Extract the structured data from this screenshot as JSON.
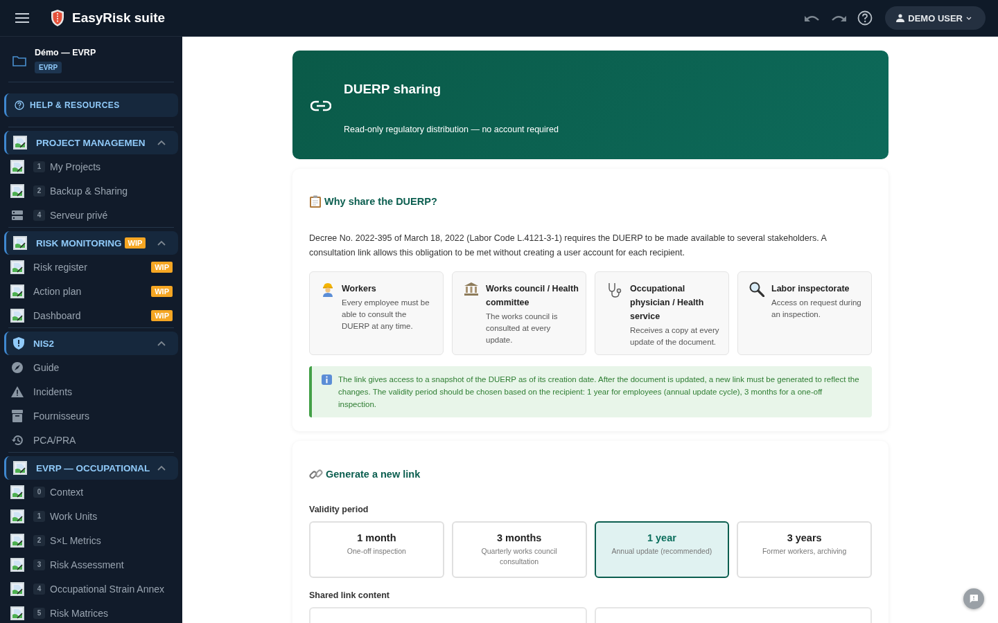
{
  "app": {
    "title": "EasyRisk suite",
    "user": "DEMO USER"
  },
  "project": {
    "name": "Démo — EVRP",
    "tag": "EVRP"
  },
  "help": {
    "label": "HELP & RESOURCES"
  },
  "sidebar": {
    "groups": [
      {
        "label": "PROJECT MANAGEMEN",
        "expanded": true,
        "items": [
          {
            "number": "1",
            "label": "My Projects"
          },
          {
            "number": "2",
            "label": "Backup & Sharing"
          },
          {
            "number": "4",
            "label": "Serveur privé"
          }
        ]
      },
      {
        "label": "RISK MONITORING",
        "badge": "WIP",
        "expanded": true,
        "items": [
          {
            "label": "Risk register",
            "badge": "WIP"
          },
          {
            "label": "Action plan",
            "badge": "WIP"
          },
          {
            "label": "Dashboard",
            "badge": "WIP"
          }
        ]
      },
      {
        "label": "NIS2",
        "expanded": true,
        "items": [
          {
            "label": "Guide"
          },
          {
            "label": "Incidents"
          },
          {
            "label": "Fournisseurs"
          },
          {
            "label": "PCA/PRA"
          }
        ]
      },
      {
        "label": "EVRP — OCCUPATIONAL",
        "expanded": true,
        "items": [
          {
            "number": "0",
            "label": "Context"
          },
          {
            "number": "1",
            "label": "Work Units"
          },
          {
            "number": "2",
            "label": "S×L Metrics"
          },
          {
            "number": "3",
            "label": "Risk Assessment"
          },
          {
            "number": "4",
            "label": "Occupational Strain Annex"
          },
          {
            "number": "5",
            "label": "Risk Matrices"
          }
        ]
      }
    ]
  },
  "hero": {
    "title": "DUERP sharing",
    "subtitle": "Read-only regulatory distribution — no account required"
  },
  "why": {
    "title": "Why share the DUERP?",
    "text": "Decree No. 2022-395 of March 18, 2022 (Labor Code L.4121-3-1) requires the DUERP to be made available to several stakeholders. A consultation link allows this obligation to be met without creating a user account for each recipient.",
    "recipients": [
      {
        "title": "Workers",
        "text": "Every employee must be able to consult the DUERP at any time."
      },
      {
        "title": "Works council / Health committee",
        "text": "The works council is consulted at every update."
      },
      {
        "title": "Occupational physician / Health service",
        "text": "Receives a copy at every update of the document."
      },
      {
        "title": "Labor inspectorate",
        "text": "Access on request during an inspection."
      }
    ],
    "note": "The link gives access to a snapshot of the DUERP as of its creation date. After the document is updated, a new link must be generated to reflect the changes. The validity period should be chosen based on the recipient: 1 year for employees (annual update cycle), 3 months for a one-off inspection."
  },
  "generate": {
    "title": "Generate a new link",
    "validity_label": "Validity period",
    "options": [
      {
        "title": "1 month",
        "text": "One-off inspection",
        "selected": false
      },
      {
        "title": "3 months",
        "text": "Quarterly works council consultation",
        "selected": false
      },
      {
        "title": "1 year",
        "text": "Annual update (recommended)",
        "selected": true
      },
      {
        "title": "3 years",
        "text": "Former workers, archiving",
        "selected": false
      }
    ],
    "content_label": "Shared link content"
  }
}
